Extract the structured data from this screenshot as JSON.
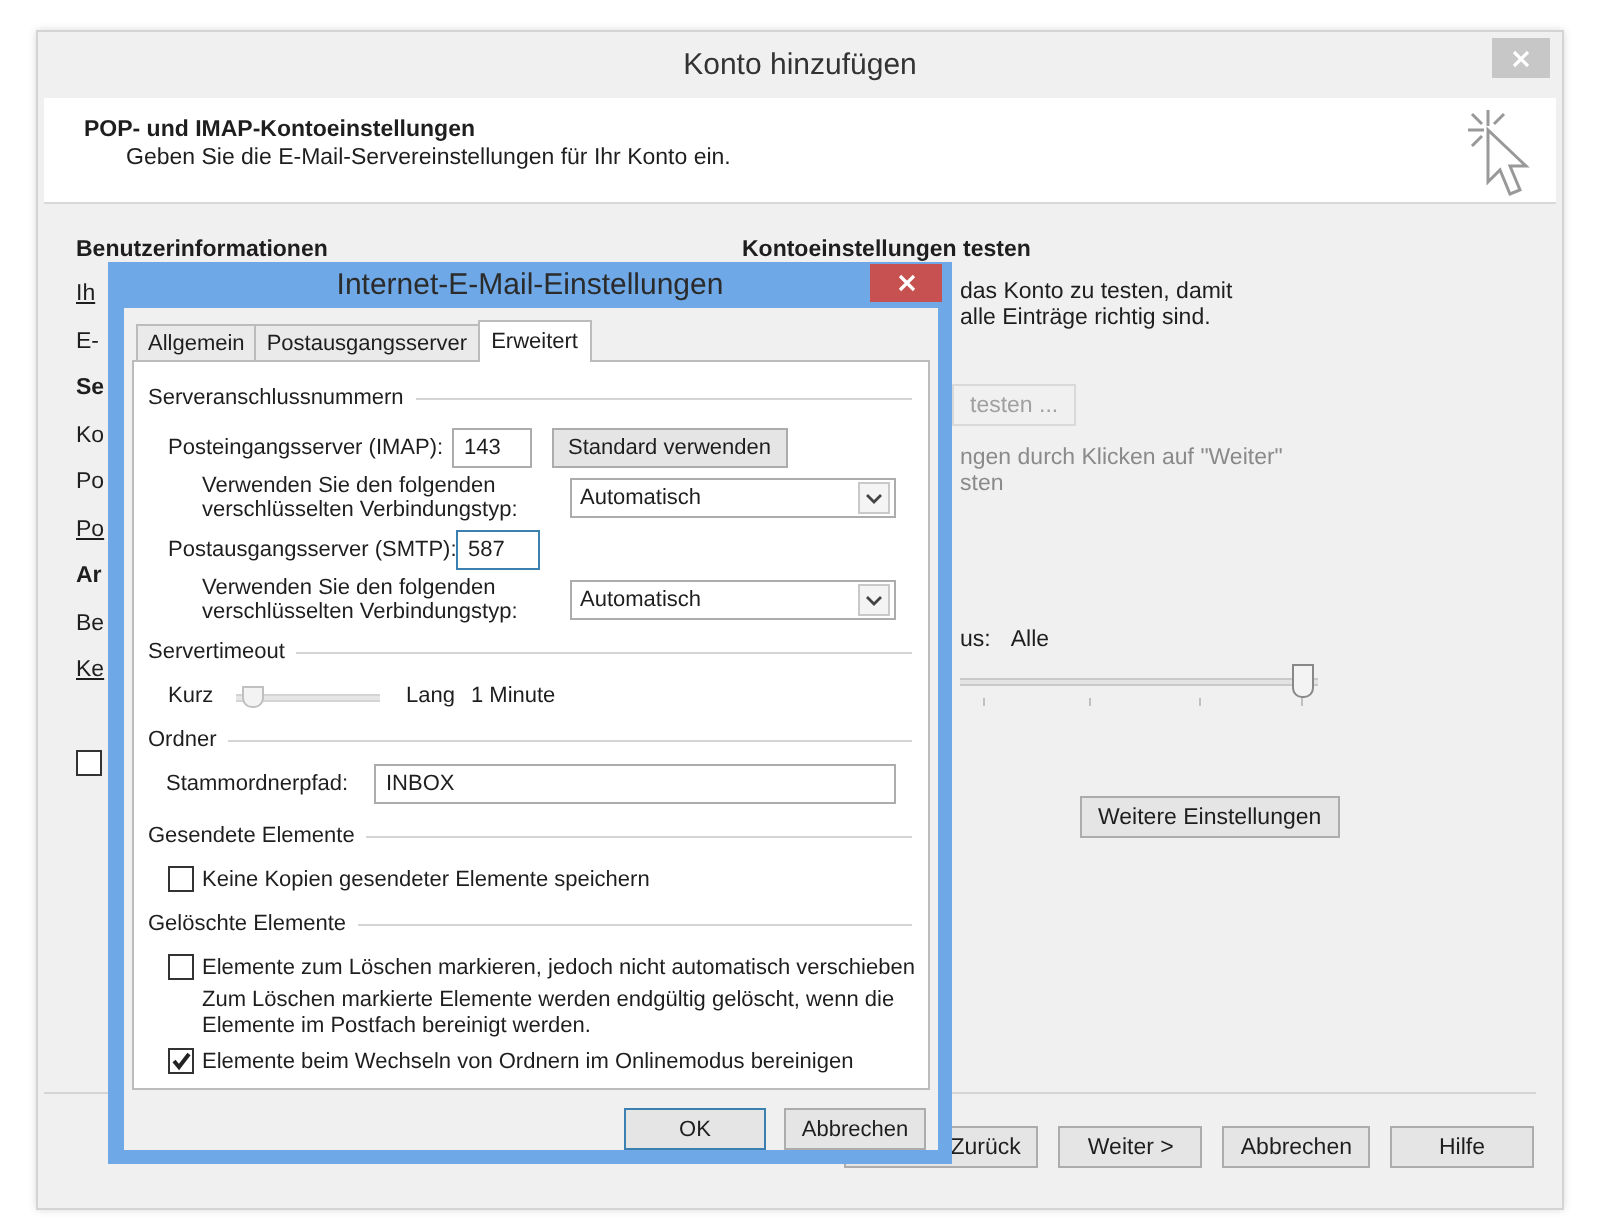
{
  "window": {
    "title": "Konto hinzufügen"
  },
  "header": {
    "title": "POP- und IMAP-Kontoeinstellungen",
    "subtitle": "Geben Sie die E-Mail-Servereinstellungen für Ihr Konto ein."
  },
  "left_column": {
    "heading": "Benutzerinformationen",
    "items": [
      {
        "text": "Ih",
        "kind": "underlined"
      },
      {
        "text": "E-",
        "kind": "plain"
      },
      {
        "text": "Se",
        "kind": "bold"
      },
      {
        "text": "Ko",
        "kind": "plain"
      },
      {
        "text": "Po",
        "kind": "plain"
      },
      {
        "text": "Po",
        "kind": "underlined"
      },
      {
        "text": "Ar",
        "kind": "bold"
      },
      {
        "text": "Be",
        "kind": "plain"
      },
      {
        "text": "Ke",
        "kind": "underlined"
      }
    ],
    "checkbox": {
      "checked": false
    }
  },
  "right_column": {
    "heading": "Kontoeinstellungen testen",
    "description": [
      "das Konto zu testen, damit",
      "alle Einträge richtig sind."
    ],
    "test_button": {
      "label": "testen ...",
      "disabled": true
    },
    "note": {
      "lines": [
        "ngen durch Klicken auf \"Weiter\"",
        "sten"
      ],
      "disabled": true
    },
    "slider": {
      "label": "us:",
      "value": "Alle",
      "level": 1
    },
    "more_button": "Weitere Einstellungen"
  },
  "footer_buttons": [
    "Zurück",
    "Weiter >",
    "Abbrechen",
    "Hilfe"
  ],
  "dialog": {
    "title": "Internet-E-Mail-Einstellungen",
    "tabs": [
      {
        "label": "Allgemein",
        "selected": false
      },
      {
        "label": "Postausgangsserver",
        "selected": false
      },
      {
        "label": "Erweitert",
        "selected": true
      }
    ],
    "sections": [
      {
        "title": "Serveranschlussnummern",
        "rows": [
          {
            "kind": "port",
            "label": "Posteingangsserver (IMAP):",
            "value": "143",
            "focused": false,
            "button": "Standard verwenden"
          },
          {
            "kind": "select",
            "label": "Verwenden Sie den folgenden verschlüsselten Verbindungstyp:",
            "value": "Automatisch"
          },
          {
            "kind": "port",
            "label": "Postausgangsserver (SMTP):",
            "value": "587",
            "focused": true
          },
          {
            "kind": "select",
            "label": "Verwenden Sie den folgenden verschlüsselten Verbindungstyp:",
            "value": "Automatisch"
          }
        ]
      },
      {
        "title": "Servertimeout",
        "rows": [
          {
            "kind": "slider",
            "min_label": "Kurz",
            "max_label": "Lang",
            "reading": "1 Minute",
            "level": 0.05
          }
        ]
      },
      {
        "title": "Ordner",
        "rows": [
          {
            "kind": "text",
            "label": "Stammordnerpfad:",
            "value": "INBOX"
          }
        ]
      },
      {
        "title": "Gesendete Elemente",
        "rows": [
          {
            "kind": "checkbox",
            "label": "Keine Kopien gesendeter Elemente speichern",
            "checked": false
          }
        ]
      },
      {
        "title": "Gelöschte Elemente",
        "rows": [
          {
            "kind": "checkbox",
            "label": "Elemente zum Löschen markieren, jedoch nicht automatisch verschieben",
            "checked": false
          },
          {
            "kind": "note",
            "text": "Zum Löschen markierte Elemente werden endgültig gelöscht, wenn die Elemente im Postfach bereinigt werden."
          },
          {
            "kind": "checkbox",
            "label": "Elemente beim Wechseln von Ordnern im Onlinemodus bereinigen",
            "checked": true
          }
        ]
      }
    ],
    "buttons": [
      {
        "label": "OK",
        "default": true
      },
      {
        "label": "Abbrechen",
        "default": false
      }
    ]
  }
}
